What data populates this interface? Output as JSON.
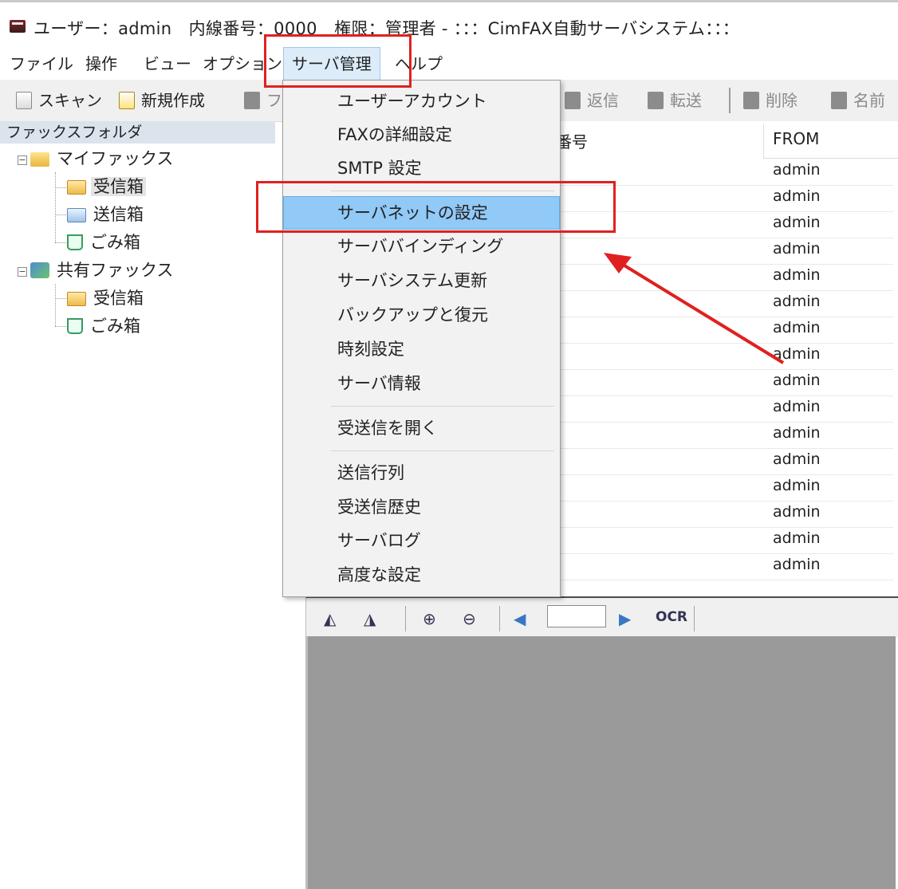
{
  "title_bar": {
    "text": "ユーザー：admin　内線番号：0000　権限：管理者 - ：：：CimFAX自動サーバシステム：：："
  },
  "menubar": {
    "items": [
      "ファイル",
      "操作",
      "ビュー",
      "オプション",
      "サーバ管理",
      "ヘルプ"
    ],
    "active": "サーバ管理"
  },
  "toolbar": {
    "scan": "スキャン",
    "new": "新規作成",
    "cut_fragment": "フ",
    "reply": "返信",
    "forward": "転送",
    "delete": "削除",
    "name": "名前"
  },
  "folder_tree": {
    "header": "ファックスフォルダ",
    "my_fax": "マイファックス",
    "my_fax_children": [
      "受信箱",
      "送信箱",
      "ごみ箱"
    ],
    "shared_fax": "共有ファックス",
    "shared_fax_children": [
      "受信箱",
      "ごみ箱"
    ]
  },
  "fax_list": {
    "columns": {
      "number_fragment": "番号",
      "from": "FROM"
    },
    "from_values": [
      "admin",
      "admin",
      "admin",
      "admin",
      "admin",
      "admin",
      "admin",
      "admin",
      "admin",
      "admin",
      "admin",
      "admin",
      "admin",
      "admin",
      "admin",
      "admin"
    ],
    "fragment_char": ")"
  },
  "viewer_toolbar": {
    "ocr": "OCR",
    "page_value": ""
  },
  "dropdown": {
    "items": [
      "ユーザーアカウント",
      "FAXの詳細設定",
      "SMTP 設定",
      "サーバネットの設定",
      "サーババインディング",
      "サーバシステム更新",
      "バックアップと復元",
      "時刻設定",
      "サーバ情報",
      "受送信を開く",
      "送信行列",
      "受送信歴史",
      "サーバログ",
      "高度な設定"
    ],
    "highlighted": "サーバネットの設定"
  },
  "annotation_colors": {
    "highlight_box": "#e02020",
    "arrow": "#e02020"
  }
}
